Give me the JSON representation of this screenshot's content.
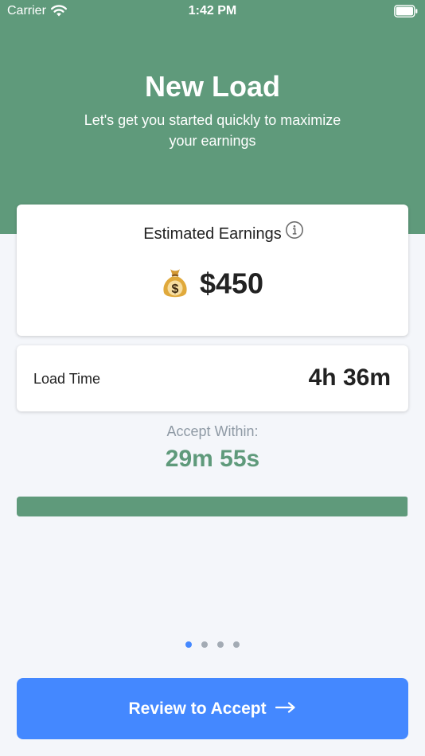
{
  "status_bar": {
    "carrier": "Carrier",
    "time": "1:42 PM"
  },
  "header": {
    "title": "New Load",
    "subtitle": "Let's get you started quickly to maximize your earnings"
  },
  "earnings": {
    "label": "Estimated Earnings",
    "icon": "money-bag-icon",
    "amount": "$450"
  },
  "load": {
    "label": "Load Time",
    "value": "4h 36m"
  },
  "accept": {
    "label": "Accept Within:",
    "countdown": "29m 55s",
    "remaining_fraction": 0.998
  },
  "pager": {
    "count": 4,
    "active_index": 0
  },
  "cta": {
    "label": "Review to Accept"
  },
  "colors": {
    "header_green": "#5f9a7b",
    "background": "#f4f6fa",
    "accent_blue": "#4488ff",
    "muted_text": "#8f9aa5"
  }
}
